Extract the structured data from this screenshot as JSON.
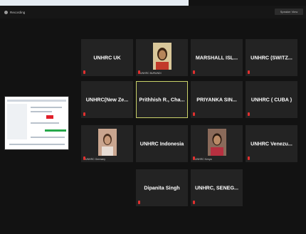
{
  "topbar": {
    "recording_label": "Recording",
    "view_label": "Speaker View"
  },
  "share_thumbnail": {
    "icon": "shared-screen-thumbnail"
  },
  "tiles": [
    {
      "name": "UNHRC UK",
      "label": ""
    },
    {
      "name": "",
      "label": "UNHRC BURUNDI",
      "photo": true
    },
    {
      "name": "MARSHALL ISL...",
      "label": ""
    },
    {
      "name": "UNHRC (SWITZ...",
      "label": ""
    },
    {
      "name": "UNHRC(New Ze...",
      "label": ""
    },
    {
      "name": "Prithhish R., Cha...",
      "label": "",
      "active": true
    },
    {
      "name": "PRIYANKA SIN...",
      "label": ""
    },
    {
      "name": "UNHRC ( CUBA )",
      "label": ""
    },
    {
      "name": "",
      "label": "UNHRC Germany",
      "photo": true
    },
    {
      "name": "UNHRC Indonesia",
      "label": ""
    },
    {
      "name": "",
      "label": "UNHRC Kenya",
      "photo": true
    },
    {
      "name": "UNHRC Venezu...",
      "label": ""
    },
    {
      "name": "Dipanita Singh",
      "label": ""
    },
    {
      "name": "UNHRC, SENEG...",
      "label": ""
    }
  ],
  "colors": {
    "background": "#121212",
    "tile": "#232323",
    "active_border": "#c9d26a",
    "mic_muted": "#e0302f"
  }
}
